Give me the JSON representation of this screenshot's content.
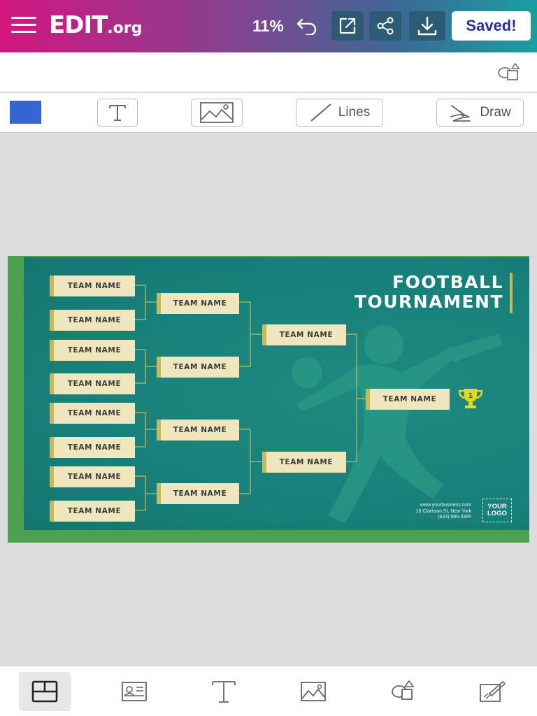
{
  "header": {
    "logo_main": "EDIT",
    "logo_suffix": ".org",
    "zoom": "11%",
    "saved_label": "Saved!"
  },
  "tools": {
    "lines_label": "Lines",
    "draw_label": "Draw"
  },
  "colors": {
    "accent": "#3465d3",
    "canvas_bg": "#18807a",
    "canvas_border": "#4ca04f",
    "team_box": "#f0e6bd",
    "trophy": "#e8d422"
  },
  "design": {
    "title_line1": "FOOTBALL",
    "title_line2": "TOURNAMENT",
    "round1": [
      "TEAM NAME",
      "TEAM NAME",
      "TEAM NAME",
      "TEAM NAME",
      "TEAM NAME",
      "TEAM NAME",
      "TEAM NAME",
      "TEAM NAME"
    ],
    "round2": [
      "TEAM NAME",
      "TEAM NAME",
      "TEAM NAME",
      "TEAM NAME"
    ],
    "round3": [
      "TEAM NAME",
      "TEAM NAME"
    ],
    "final": "TEAM NAME",
    "trophy_number": "1",
    "contact_web": "www.yourbusiness.com",
    "contact_address": "16 Clarkson St, New York",
    "contact_phone": "(633) 886-3345",
    "logo_line1": "YOUR",
    "logo_line2": "LOGO"
  }
}
